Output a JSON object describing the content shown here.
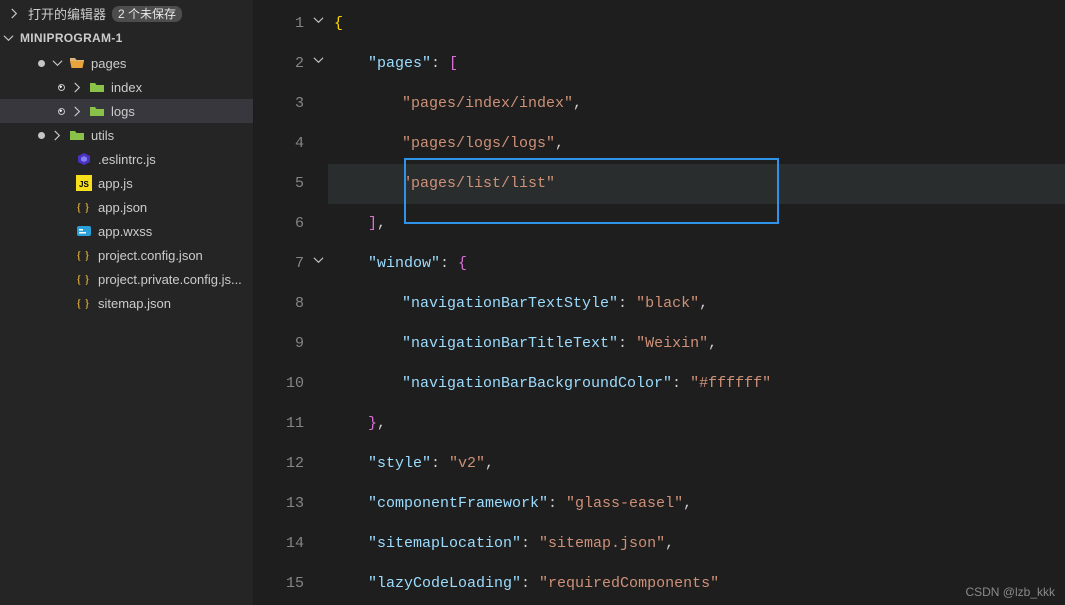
{
  "sidebar": {
    "openEditorsLabel": "打开的编辑器",
    "unsavedBadge": "2 个未保存",
    "projectName": "MINIPROGRAM-1",
    "items": [
      {
        "name": "pages",
        "iconKind": "folder-open-orange",
        "depth": 1,
        "expandable": true,
        "expanded": true,
        "modified": true,
        "selected": false
      },
      {
        "name": "index",
        "iconKind": "folder-green",
        "depth": 2,
        "expandable": true,
        "expanded": false,
        "modified": false,
        "selected": false
      },
      {
        "name": "logs",
        "iconKind": "folder-green",
        "depth": 2,
        "expandable": true,
        "expanded": false,
        "modified": false,
        "selected": true
      },
      {
        "name": "utils",
        "iconKind": "folder-green",
        "depth": 1,
        "expandable": true,
        "expanded": false,
        "modified": true,
        "selected": false
      },
      {
        "name": ".eslintrc.js",
        "iconKind": "eslint",
        "depth": 2,
        "expandable": false,
        "modified": false,
        "selected": false
      },
      {
        "name": "app.js",
        "iconKind": "js",
        "depth": 2,
        "expandable": false,
        "modified": false,
        "selected": false
      },
      {
        "name": "app.json",
        "iconKind": "json",
        "depth": 2,
        "expandable": false,
        "modified": false,
        "selected": false
      },
      {
        "name": "app.wxss",
        "iconKind": "wxss",
        "depth": 2,
        "expandable": false,
        "modified": false,
        "selected": false
      },
      {
        "name": "project.config.json",
        "iconKind": "json",
        "depth": 2,
        "expandable": false,
        "modified": false,
        "selected": false
      },
      {
        "name": "project.private.config.js...",
        "iconKind": "json",
        "depth": 2,
        "expandable": false,
        "modified": false,
        "selected": false
      },
      {
        "name": "sitemap.json",
        "iconKind": "json",
        "depth": 2,
        "expandable": false,
        "modified": false,
        "selected": false
      }
    ]
  },
  "code": {
    "lines": [
      {
        "n": 1,
        "fold": true,
        "tokens": [
          [
            "brace",
            "{"
          ]
        ]
      },
      {
        "n": 2,
        "fold": true,
        "indent": 1,
        "tokens": [
          [
            "key",
            "\"pages\""
          ],
          [
            "punc",
            ": "
          ],
          [
            "brace2",
            "["
          ]
        ]
      },
      {
        "n": 3,
        "indent": 2,
        "tokens": [
          [
            "str",
            "\"pages/index/index\""
          ],
          [
            "punc",
            ","
          ]
        ]
      },
      {
        "n": 4,
        "indent": 2,
        "tokens": [
          [
            "str",
            "\"pages/logs/logs\""
          ],
          [
            "punc",
            ","
          ]
        ]
      },
      {
        "n": 5,
        "indent": 2,
        "tokens": [
          [
            "str",
            "\"pages/list/list\""
          ]
        ],
        "highlight": true
      },
      {
        "n": 6,
        "indent": 1,
        "tokens": [
          [
            "brace2",
            "]"
          ],
          [
            "punc",
            ","
          ]
        ]
      },
      {
        "n": 7,
        "fold": true,
        "indent": 1,
        "tokens": [
          [
            "key",
            "\"window\""
          ],
          [
            "punc",
            ": "
          ],
          [
            "brace2",
            "{"
          ]
        ]
      },
      {
        "n": 8,
        "indent": 2,
        "tokens": [
          [
            "key",
            "\"navigationBarTextStyle\""
          ],
          [
            "punc",
            ": "
          ],
          [
            "str",
            "\"black\""
          ],
          [
            "punc",
            ","
          ]
        ]
      },
      {
        "n": 9,
        "indent": 2,
        "tokens": [
          [
            "key",
            "\"navigationBarTitleText\""
          ],
          [
            "punc",
            ": "
          ],
          [
            "str",
            "\"Weixin\""
          ],
          [
            "punc",
            ","
          ]
        ]
      },
      {
        "n": 10,
        "indent": 2,
        "tokens": [
          [
            "key",
            "\"navigationBarBackgroundColor\""
          ],
          [
            "punc",
            ": "
          ],
          [
            "str",
            "\"#ffffff\""
          ]
        ]
      },
      {
        "n": 11,
        "indent": 1,
        "tokens": [
          [
            "brace2",
            "}"
          ],
          [
            "punc",
            ","
          ]
        ]
      },
      {
        "n": 12,
        "indent": 1,
        "tokens": [
          [
            "key",
            "\"style\""
          ],
          [
            "punc",
            ": "
          ],
          [
            "str",
            "\"v2\""
          ],
          [
            "punc",
            ","
          ]
        ]
      },
      {
        "n": 13,
        "indent": 1,
        "tokens": [
          [
            "key",
            "\"componentFramework\""
          ],
          [
            "punc",
            ": "
          ],
          [
            "str",
            "\"glass-easel\""
          ],
          [
            "punc",
            ","
          ]
        ]
      },
      {
        "n": 14,
        "indent": 1,
        "tokens": [
          [
            "key",
            "\"sitemapLocation\""
          ],
          [
            "punc",
            ": "
          ],
          [
            "str",
            "\"sitemap.json\""
          ],
          [
            "punc",
            ","
          ]
        ]
      },
      {
        "n": 15,
        "indent": 1,
        "tokens": [
          [
            "key",
            "\"lazyCodeLoading\""
          ],
          [
            "punc",
            ": "
          ],
          [
            "str",
            "\"requiredComponents\""
          ]
        ]
      }
    ],
    "selectionBox": {
      "topLine": 5,
      "heightLines": 1.55,
      "leftPx": 76,
      "widthPx": 375
    }
  },
  "watermark": "CSDN @lzb_kkk"
}
